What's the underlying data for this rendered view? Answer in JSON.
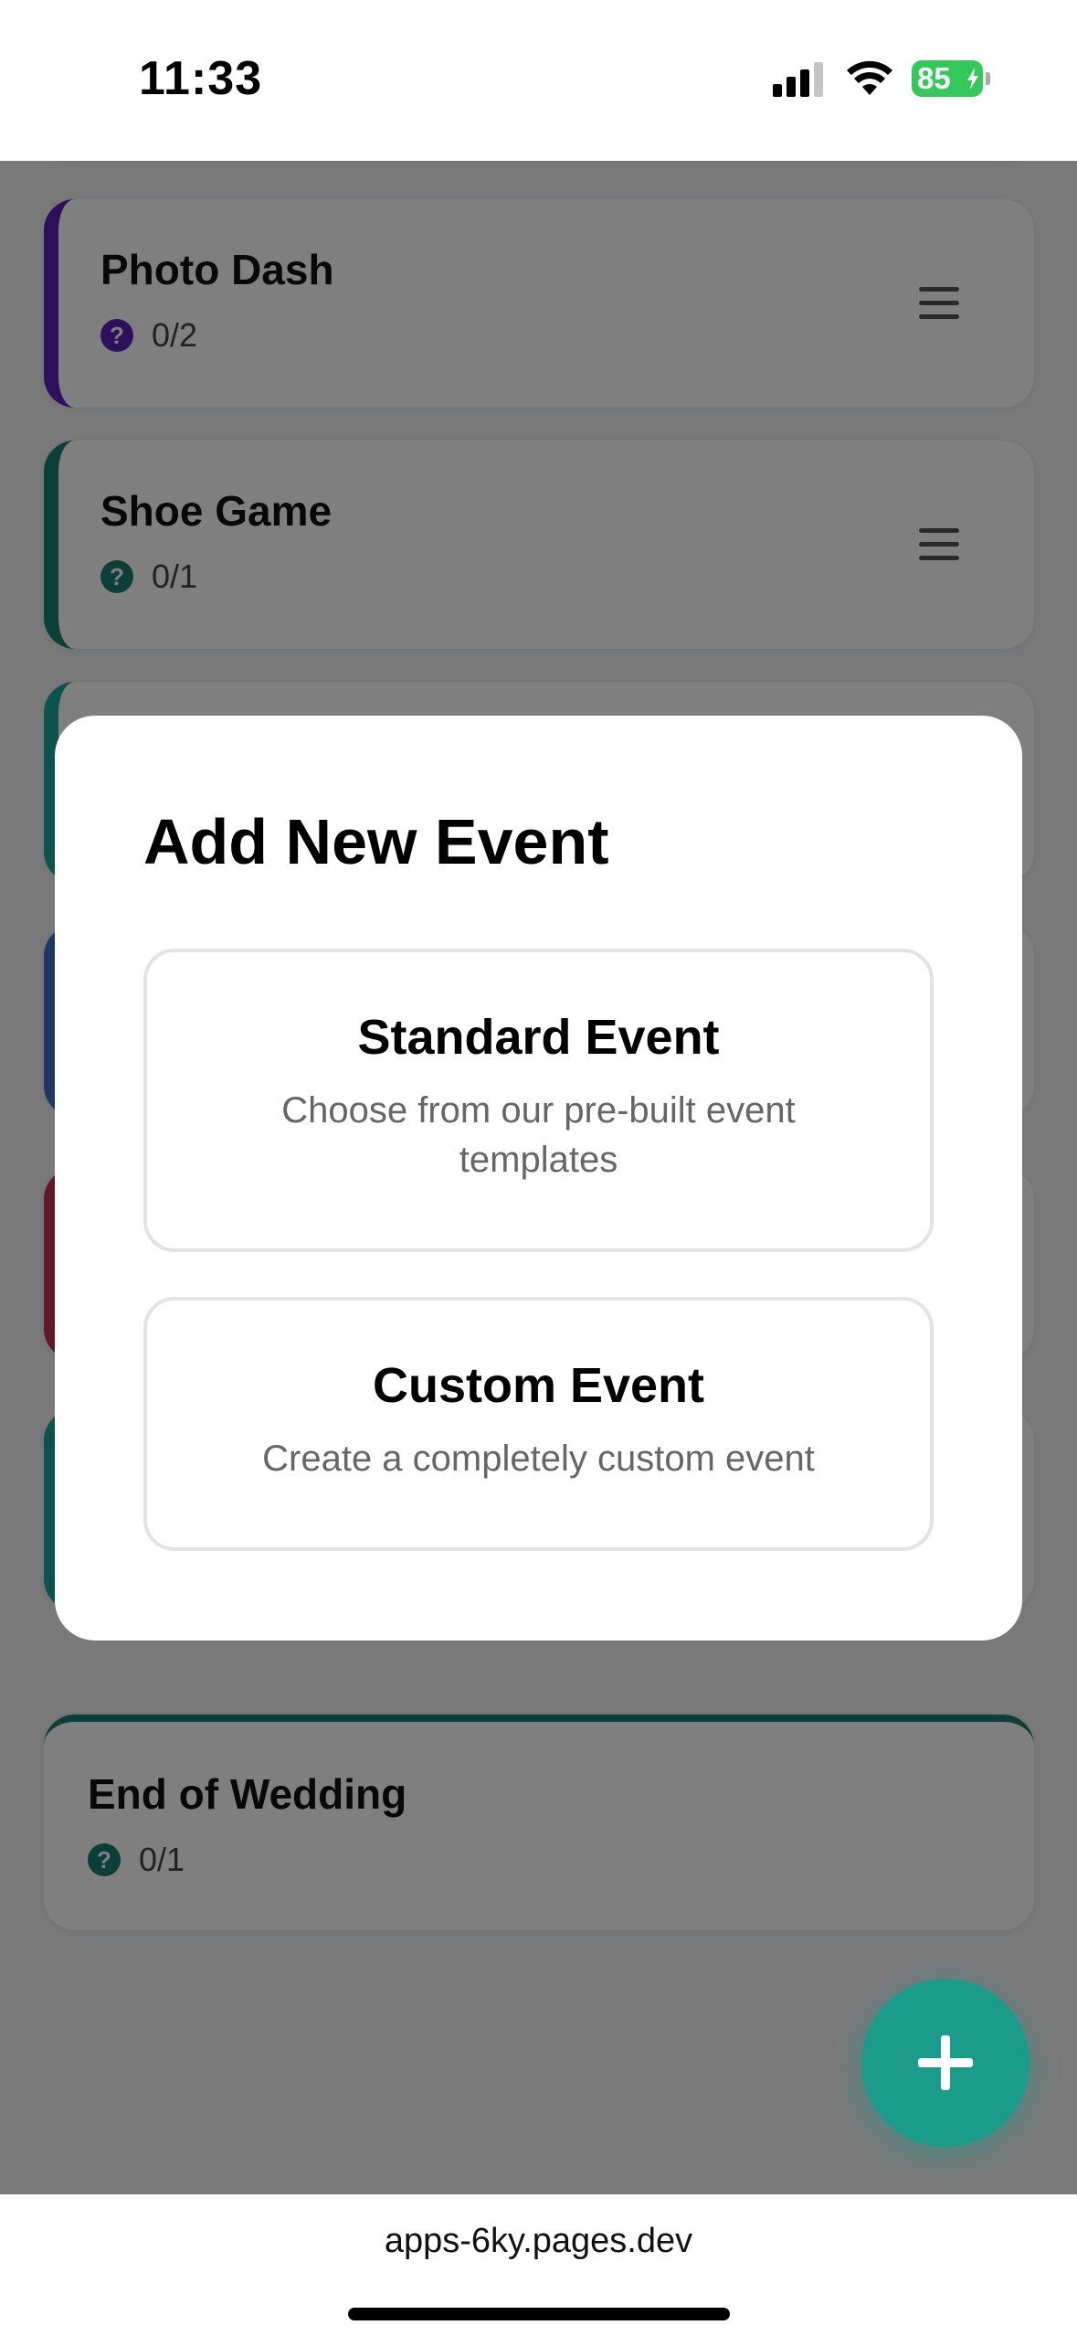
{
  "status_bar": {
    "time": "11:33",
    "battery": "85",
    "icons": [
      "signal-icon",
      "wifi-icon",
      "battery-icon"
    ]
  },
  "events": [
    {
      "title": "Photo Dash",
      "progress": "0/2",
      "accent": "#5b21b6"
    },
    {
      "title": "Shoe Game",
      "progress": "0/1",
      "accent": "#1a7f72"
    },
    {
      "title": "End of Wedding",
      "progress": "0/1",
      "accent": "#1a7f72"
    }
  ],
  "hidden_card_accents": [
    "#1aa79a",
    "#3d6fc4",
    "#c2344a",
    "#1aa79a"
  ],
  "modal": {
    "title": "Add New Event",
    "options": [
      {
        "title": "Standard Event",
        "description": "Choose from our pre-built event templates"
      },
      {
        "title": "Custom Event",
        "description": "Create a completely custom event"
      }
    ]
  },
  "fab": {
    "icon": "plus-icon",
    "color": "#1b9c8a"
  },
  "browser": {
    "url": "apps-6ky.pages.dev"
  }
}
